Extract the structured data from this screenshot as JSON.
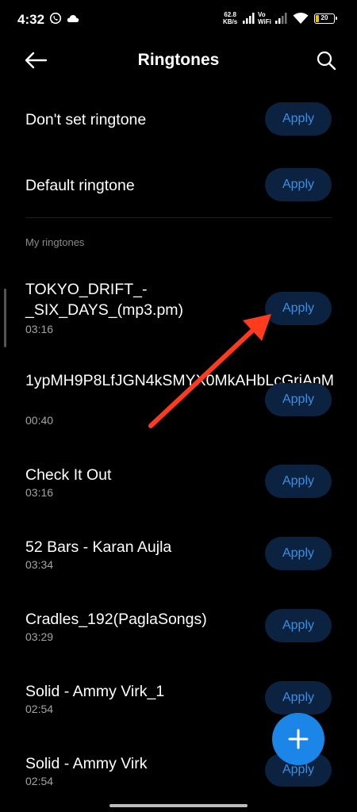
{
  "status_bar": {
    "time": "4:32",
    "net_speed_value": "62.8",
    "net_speed_unit": "KB/s",
    "vowifi_top": "Vo",
    "vowifi_bottom": "WiFi",
    "battery": "20"
  },
  "header": {
    "title": "Ringtones",
    "back_icon": "arrow-left-icon",
    "search_icon": "search-icon"
  },
  "apply_label": "Apply",
  "top_options": [
    {
      "label": "Don't set ringtone"
    },
    {
      "label": "Default ringtone"
    }
  ],
  "section_label": "My ringtones",
  "ringtones": [
    {
      "name": "TOKYO_DRIFT_-_SIX_DAYS_(mp3.pm)",
      "duration": "03:16"
    },
    {
      "name": "1ypMH9P8LfJGN4kSMYX0MkAHbLcGrjAnM",
      "duration": "00:40"
    },
    {
      "name": "Check It Out",
      "duration": "03:16"
    },
    {
      "name": "52 Bars - Karan Aujla",
      "duration": "03:34"
    },
    {
      "name": "Cradles_192(PaglaSongs)",
      "duration": "03:29"
    },
    {
      "name": "Solid - Ammy Virk_1",
      "duration": "02:54"
    },
    {
      "name": "Solid - Ammy Virk",
      "duration": "02:54"
    }
  ],
  "fab_icon": "plus-icon",
  "colors": {
    "background": "#000000",
    "apply_button_bg": "#0b2340",
    "apply_button_text": "#3a8fe2",
    "fab": "#1b86e8",
    "annotation_arrow": "#ff3b1f"
  }
}
